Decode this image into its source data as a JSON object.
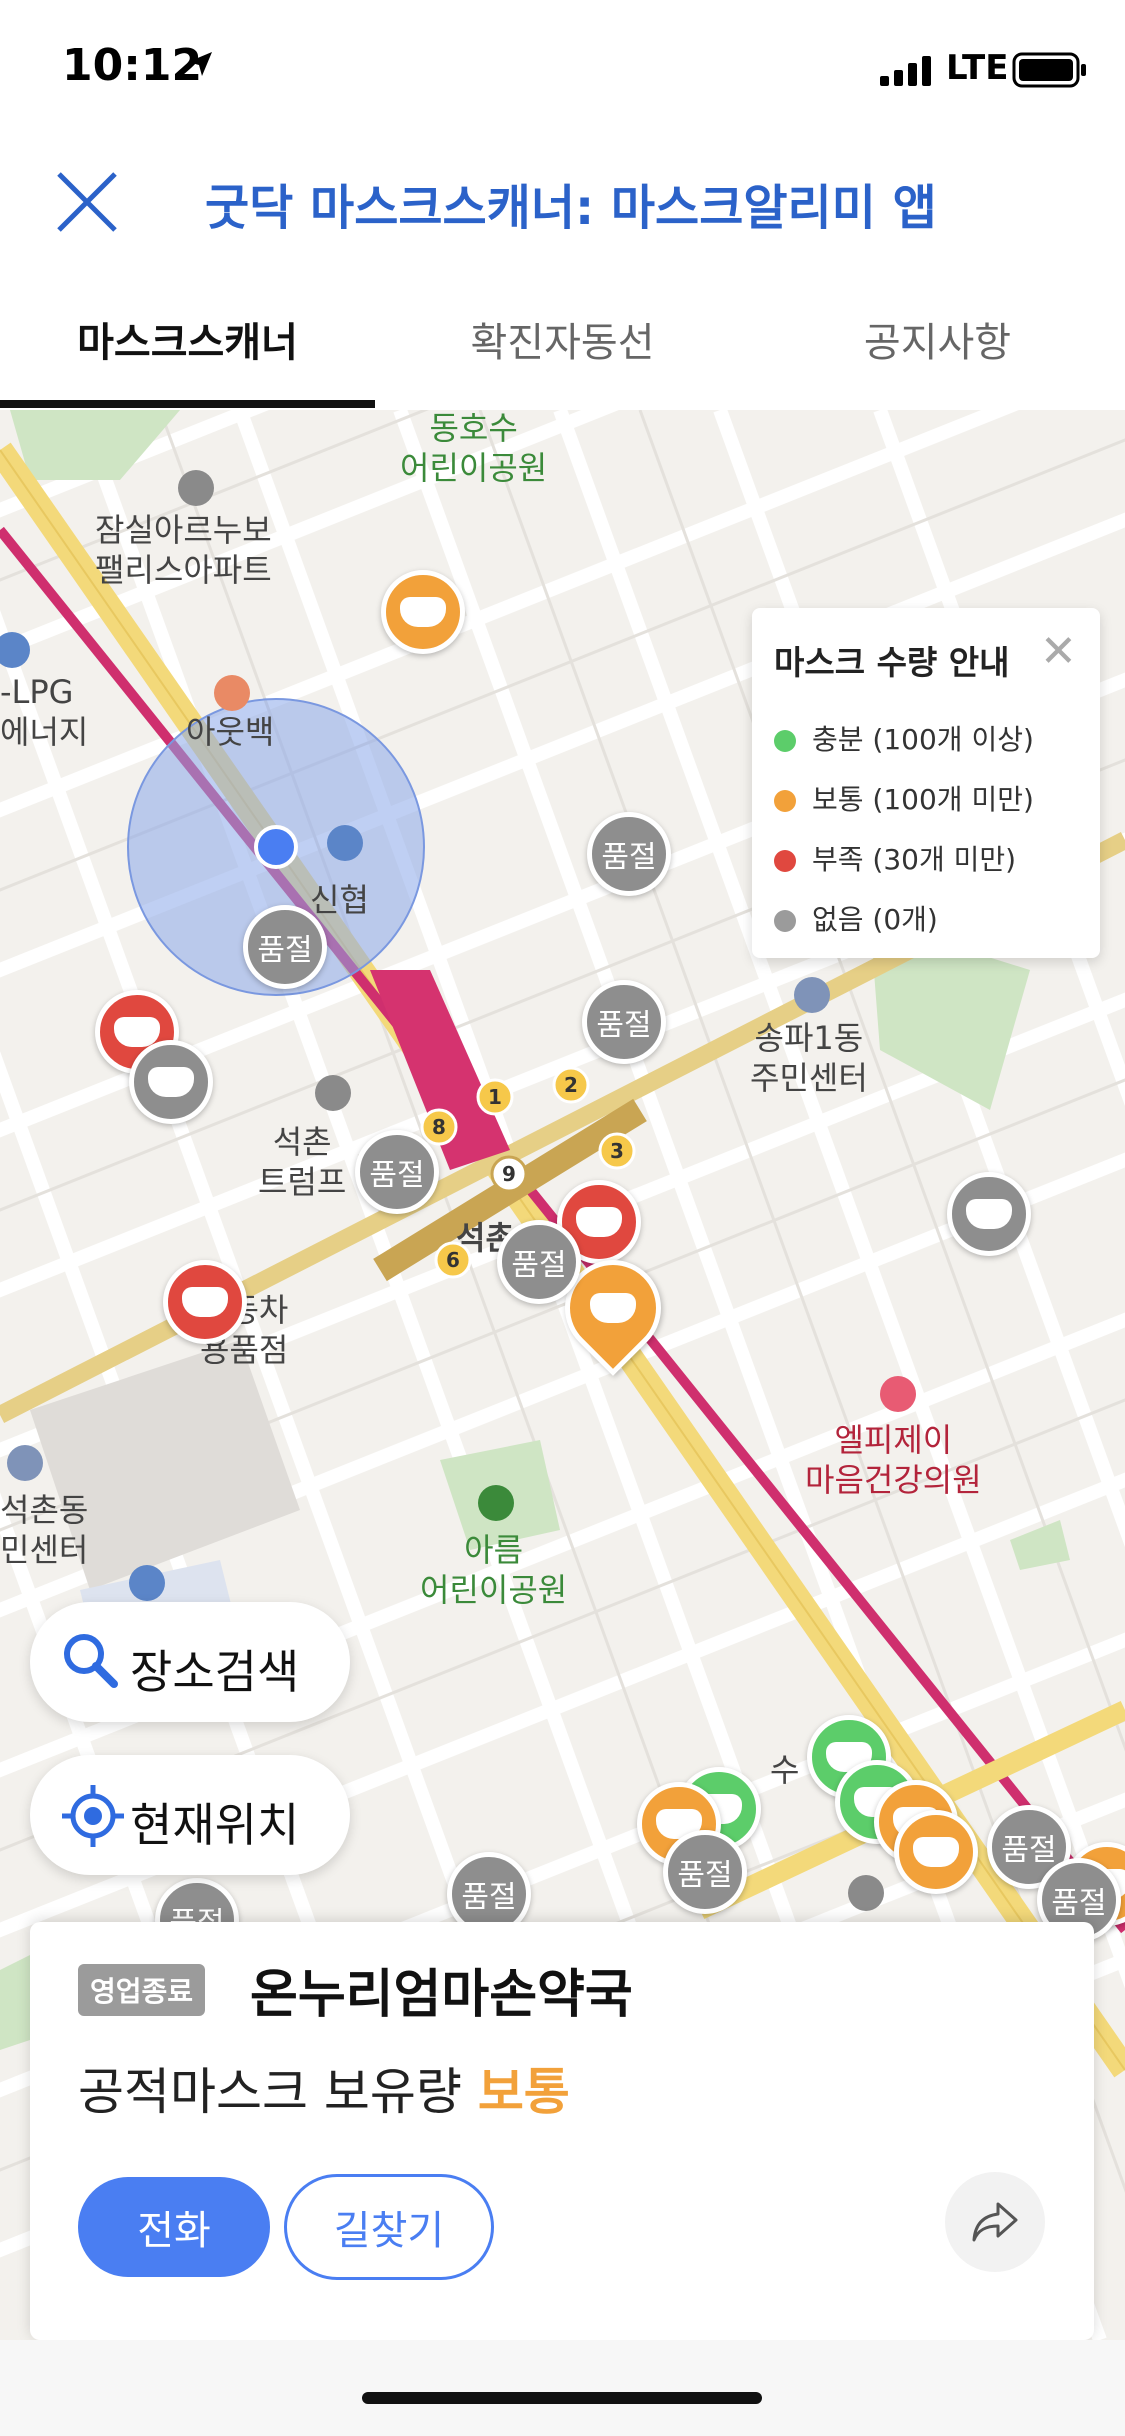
{
  "status": {
    "time": "10:12",
    "network": "LTE"
  },
  "header": {
    "title": "굿닥 마스크스캐너: 마스크알리미 앱"
  },
  "tabs": [
    {
      "label": "마스크스캐너",
      "active": true
    },
    {
      "label": "확진자동선",
      "active": false
    },
    {
      "label": "공지사항",
      "active": false
    }
  ],
  "map": {
    "labels": {
      "park1": "동호수\n어린이공원",
      "apt": "잠실아르누보\n팰리스아파트",
      "lpg": "-LPG\n에너지",
      "outback": "아웃백",
      "shinhyup": "신협",
      "songpa": "송파1동\n주민센터",
      "seokchon_trump": "석촌\n트럼프",
      "station": "석촌역",
      "carshop": "자동차\n용품점",
      "lpj": "엘피제이\n마음건강의원",
      "center": "석촌동\n민센터",
      "park2": "아름\n어린이공원",
      "su": "수"
    },
    "soldout_text": "품절",
    "subway_exits": [
      "1",
      "2",
      "3",
      "6",
      "8",
      "9"
    ],
    "legend": {
      "title": "마스크 수량 안내",
      "items": [
        {
          "label": "충분 (100개 이상)",
          "color": "#5ccd6a"
        },
        {
          "label": "보통 (100개 미만)",
          "color": "#f2a13a"
        },
        {
          "label": "부족 (30개 미만)",
          "color": "#e0483f"
        },
        {
          "label": "없음 (0개)",
          "color": "#9b9b9b"
        }
      ]
    },
    "buttons": {
      "search": "장소검색",
      "location": "현재위치"
    }
  },
  "card": {
    "badge": "영업종료",
    "name": "온누리엄마손약국",
    "stock_prefix": "공적마스크 보유량",
    "stock_level": "보통",
    "call": "전화",
    "route": "길찾기"
  }
}
